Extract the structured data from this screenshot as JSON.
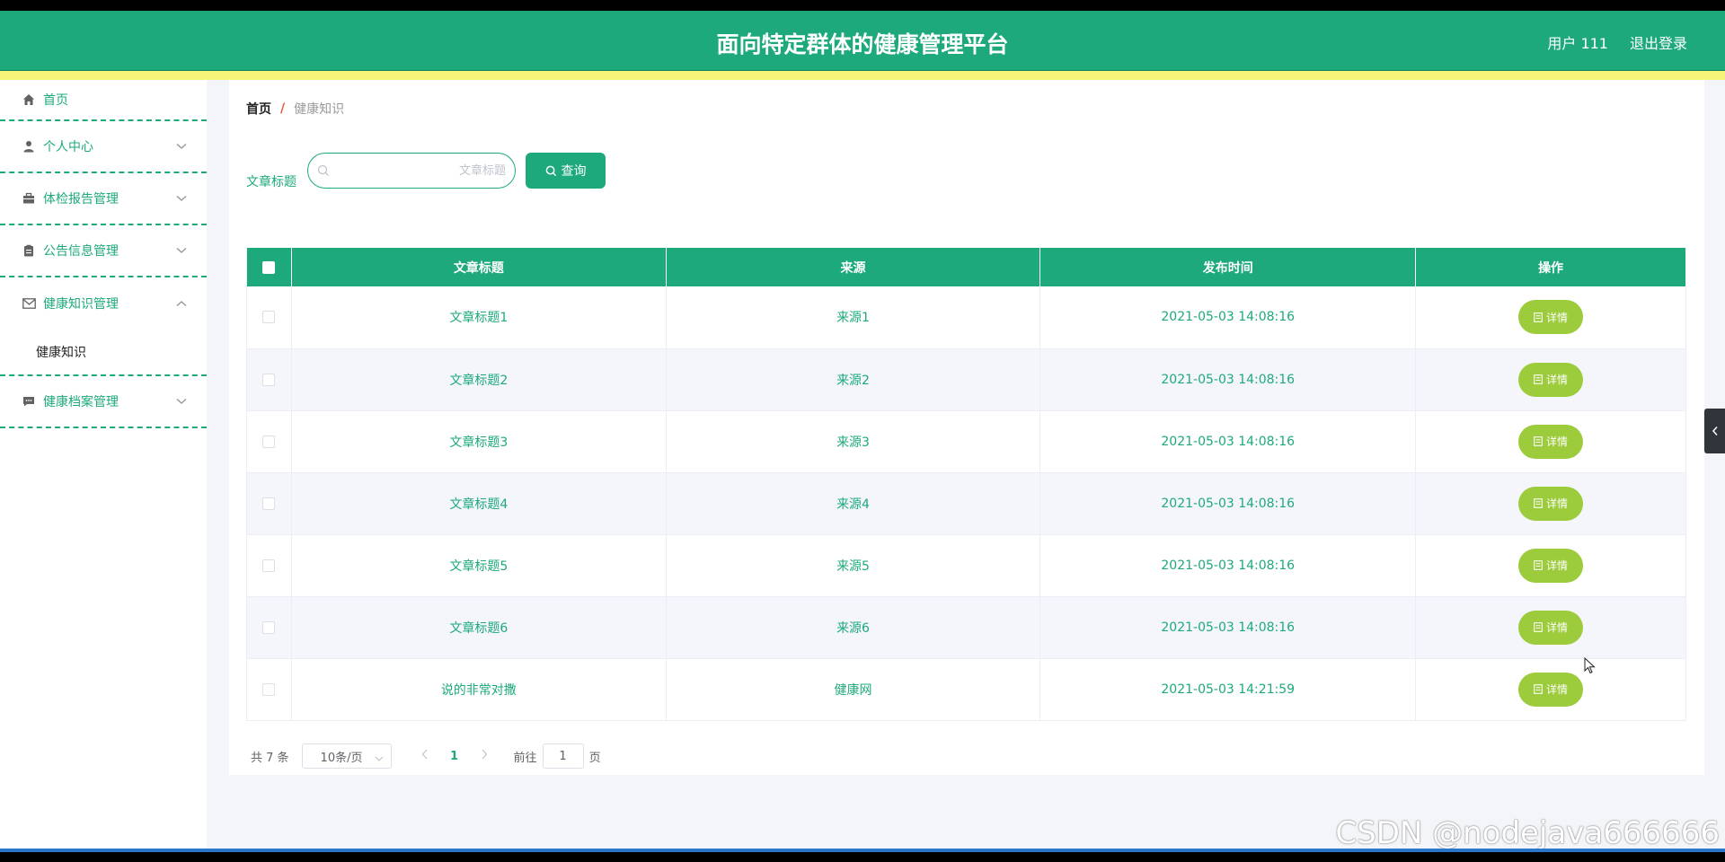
{
  "header": {
    "title": "面向特定群体的健康管理平台",
    "user": "用户 111",
    "logout": "退出登录"
  },
  "sidebar": {
    "items": [
      {
        "label": "首页",
        "icon": "home-icon"
      },
      {
        "label": "个人中心",
        "icon": "user-icon"
      },
      {
        "label": "体检报告管理",
        "icon": "briefcase-icon"
      },
      {
        "label": "公告信息管理",
        "icon": "clipboard-icon"
      },
      {
        "label": "健康知识管理",
        "icon": "mail-icon",
        "expanded": true,
        "children": [
          "健康知识"
        ]
      },
      {
        "label": "健康档案管理",
        "icon": "message-icon"
      }
    ]
  },
  "breadcrumb": {
    "home": "首页",
    "separator": "/",
    "current": "健康知识"
  },
  "search": {
    "label": "文章标题",
    "placeholder": "文章标题",
    "value": "",
    "button": "查询"
  },
  "table": {
    "headers": [
      "文章标题",
      "来源",
      "发布时间",
      "操作"
    ],
    "action_label": "详情",
    "rows": [
      {
        "title": "文章标题1",
        "source": "来源1",
        "time": "2021-05-03 14:08:16"
      },
      {
        "title": "文章标题2",
        "source": "来源2",
        "time": "2021-05-03 14:08:16"
      },
      {
        "title": "文章标题3",
        "source": "来源3",
        "time": "2021-05-03 14:08:16"
      },
      {
        "title": "文章标题4",
        "source": "来源4",
        "time": "2021-05-03 14:08:16"
      },
      {
        "title": "文章标题5",
        "source": "来源5",
        "time": "2021-05-03 14:08:16"
      },
      {
        "title": "文章标题6",
        "source": "来源6",
        "time": "2021-05-03 14:08:16"
      },
      {
        "title": "说的非常对撒",
        "source": "健康网",
        "time": "2021-05-03 14:21:59"
      }
    ]
  },
  "pagination": {
    "total": "共 7 条",
    "page_size": "10条/页",
    "current_page": "1",
    "goto_label": "前往",
    "goto_value": "1",
    "page_suffix": "页"
  },
  "watermark": "CSDN @nodejava666666",
  "colors": {
    "primary": "#1da97c",
    "accent_stripe": "#f6f57a",
    "detail_button": "#9ccb3b"
  }
}
